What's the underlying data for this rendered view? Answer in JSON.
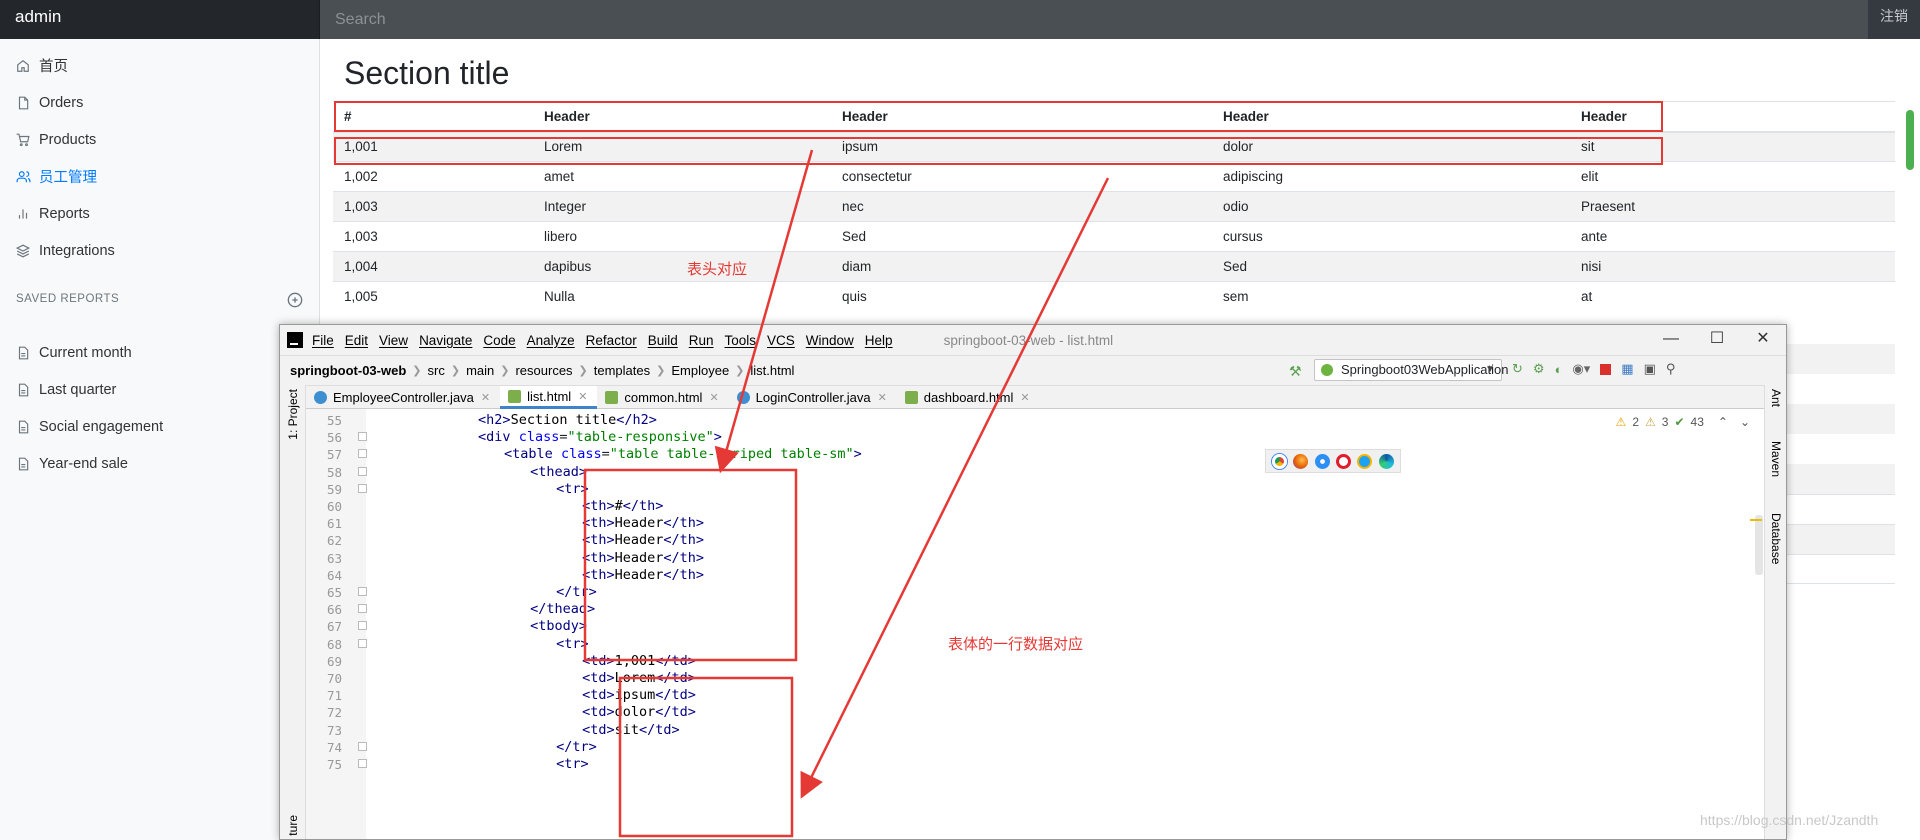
{
  "navbar": {
    "brand": "admin",
    "search_placeholder": "Search",
    "signout": "注销"
  },
  "sidebar": {
    "items": [
      {
        "label": "首页",
        "icon": "home-icon"
      },
      {
        "label": "Orders",
        "icon": "file-icon"
      },
      {
        "label": "Products",
        "icon": "shopping-cart-icon"
      },
      {
        "label": "员工管理",
        "icon": "users-icon",
        "active": true
      },
      {
        "label": "Reports",
        "icon": "bar-chart-icon"
      },
      {
        "label": "Integrations",
        "icon": "layers-icon"
      }
    ],
    "saved_heading": "SAVED REPORTS",
    "saved_items": [
      "Current month",
      "Last quarter",
      "Social engagement",
      "Year-end sale"
    ]
  },
  "main": {
    "title": "Section title",
    "columns": [
      "#",
      "Header",
      "Header",
      "Header",
      "Header"
    ],
    "rows": [
      [
        "1,001",
        "Lorem",
        "ipsum",
        "dolor",
        "sit"
      ],
      [
        "1,002",
        "amet",
        "consectetur",
        "adipiscing",
        "elit"
      ],
      [
        "1,003",
        "Integer",
        "nec",
        "odio",
        "Praesent"
      ],
      [
        "1,003",
        "libero",
        "Sed",
        "cursus",
        "ante"
      ],
      [
        "1,004",
        "dapibus",
        "diam",
        "Sed",
        "nisi"
      ],
      [
        "1,005",
        "Nulla",
        "quis",
        "sem",
        "at"
      ]
    ]
  },
  "annotations": {
    "header_note": "表头对应",
    "row_note": "表体的一行数据对应"
  },
  "ide": {
    "menu": [
      "File",
      "Edit",
      "View",
      "Navigate",
      "Code",
      "Analyze",
      "Refactor",
      "Build",
      "Run",
      "Tools",
      "VCS",
      "Window",
      "Help"
    ],
    "window_title": "springboot-03-web - list.html",
    "breadcrumb": [
      "springboot-03-web",
      "src",
      "main",
      "resources",
      "templates",
      "Employee",
      "list.html"
    ],
    "run_config": "Springboot03WebApplication",
    "tabs": [
      {
        "label": "EmployeeController.java",
        "kind": "java"
      },
      {
        "label": "list.html",
        "kind": "html",
        "active": true
      },
      {
        "label": "common.html",
        "kind": "html"
      },
      {
        "label": "LoginController.java",
        "kind": "java"
      },
      {
        "label": "dashboard.html",
        "kind": "html"
      }
    ],
    "left_panel": "1: Project",
    "left_panel_bottom": "ture",
    "right_panels": [
      "Ant",
      "Maven",
      "Database"
    ],
    "inspections": {
      "warnings": "2",
      "weak": "3",
      "ok": "43"
    },
    "code_lines": [
      {
        "num": "55",
        "text": "<h2>Section title</h2>",
        "indent": 8
      },
      {
        "num": "56",
        "text": "<div class=\"table-responsive\">",
        "indent": 8
      },
      {
        "num": "57",
        "text": "<table class=\"table table-striped table-sm\">",
        "indent": 12
      },
      {
        "num": "58",
        "text": "<thead>",
        "indent": 16
      },
      {
        "num": "59",
        "text": "<tr>",
        "indent": 20
      },
      {
        "num": "60",
        "text": "<th>#</th>",
        "indent": 24
      },
      {
        "num": "61",
        "text": "<th>Header</th>",
        "indent": 24
      },
      {
        "num": "62",
        "text": "<th>Header</th>",
        "indent": 24
      },
      {
        "num": "63",
        "text": "<th>Header</th>",
        "indent": 24
      },
      {
        "num": "64",
        "text": "<th>Header</th>",
        "indent": 24
      },
      {
        "num": "65",
        "text": "</tr>",
        "indent": 20
      },
      {
        "num": "66",
        "text": "</thead>",
        "indent": 16
      },
      {
        "num": "67",
        "text": "<tbody>",
        "indent": 16
      },
      {
        "num": "68",
        "text": "<tr>",
        "indent": 20
      },
      {
        "num": "69",
        "text": "<td>1,001</td>",
        "indent": 24
      },
      {
        "num": "70",
        "text": "<td>Lorem</td>",
        "indent": 24
      },
      {
        "num": "71",
        "text": "<td>ipsum</td>",
        "indent": 24
      },
      {
        "num": "72",
        "text": "<td>dolor</td>",
        "indent": 24
      },
      {
        "num": "73",
        "text": "<td>sit</td>",
        "indent": 24
      },
      {
        "num": "74",
        "text": "</tr>",
        "indent": 20
      },
      {
        "num": "75",
        "text": "<tr>",
        "indent": 20
      }
    ]
  },
  "watermark": "https://blog.csdn.net/Jzandth",
  "colors": {
    "accent": "#007bff",
    "annotation": "#e53935",
    "navbar": "#343a40"
  }
}
